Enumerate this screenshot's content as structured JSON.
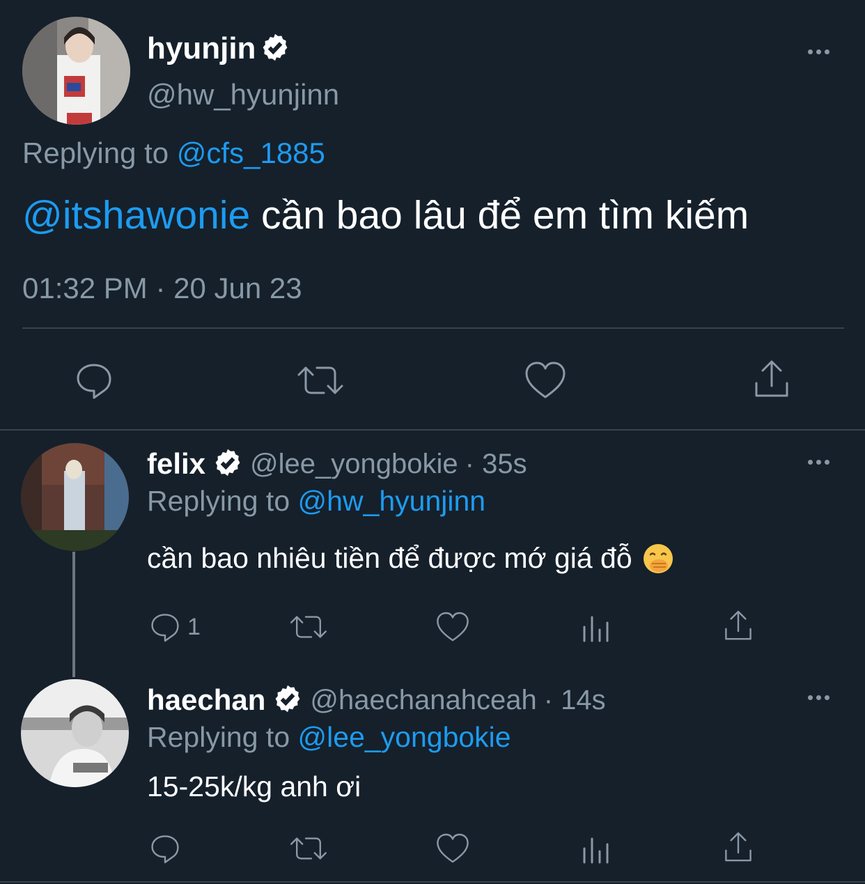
{
  "main_tweet": {
    "display_name": "hyunjin",
    "handle": "@hw_hyunjinn",
    "replying_label": "Replying to",
    "replying_to": "@cfs_1885",
    "mention": "@itshawonie",
    "text": "cần bao lâu để em tìm kiếm",
    "timestamp": "01:32 PM · 20 Jun 23"
  },
  "replies": [
    {
      "display_name": "felix",
      "handle": "@lee_yongbokie",
      "time": "· 35s",
      "replying_label": "Replying to",
      "replying_to": "@hw_hyunjinn",
      "text": "cần bao nhiêu tiền để được mớ giá đỗ",
      "emoji": "🤭",
      "reply_count": "1"
    },
    {
      "display_name": "haechan",
      "handle": "@haechanahceah",
      "time": "· 14s",
      "replying_label": "Replying to",
      "replying_to": "@lee_yongbokie",
      "text": "15-25k/kg anh ơi"
    }
  ],
  "icons": [
    "verified-badge-icon",
    "more-options-icon",
    "reply-icon",
    "retweet-icon",
    "like-icon",
    "share-icon",
    "analytics-icon"
  ],
  "colors": {
    "background": "#15202b",
    "link": "#1d9bf0",
    "muted": "#8899a6",
    "divider": "#38444d"
  }
}
